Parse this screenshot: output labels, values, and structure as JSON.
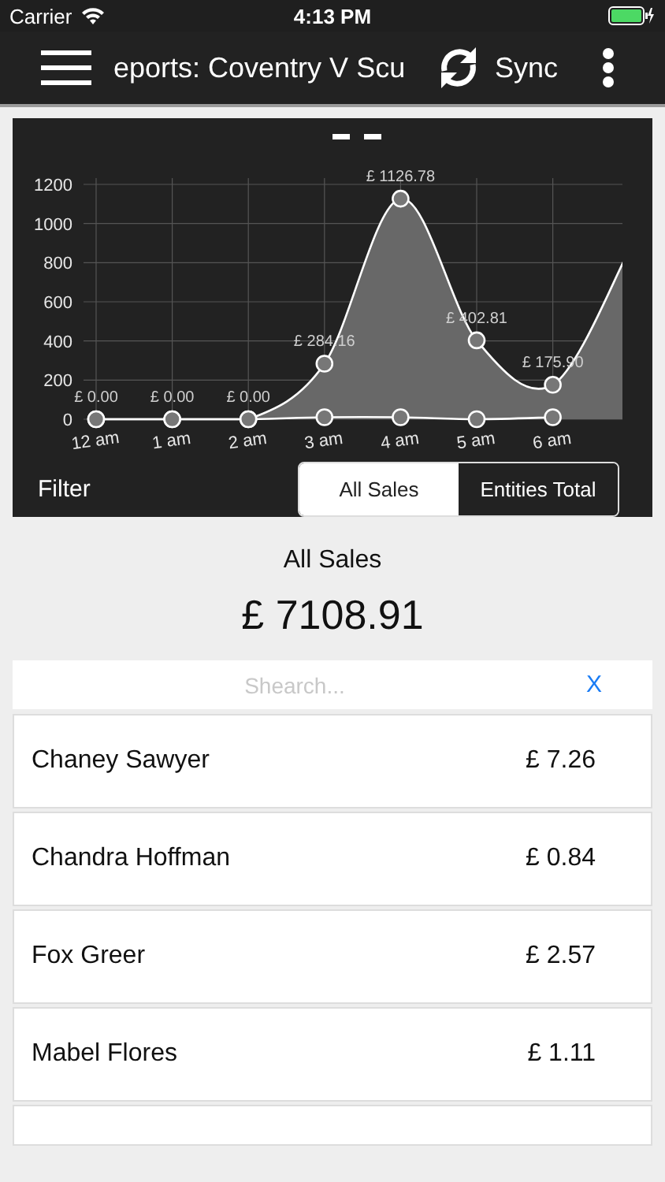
{
  "status_bar": {
    "carrier": "Carrier",
    "time": "4:13 PM"
  },
  "nav_bar": {
    "title": "eports: Coventry V Scu",
    "sync_label": "Sync"
  },
  "chart": {
    "tail_rises_past_edge": true,
    "chart_data": {
      "type": "line",
      "grid": true,
      "categories": [
        "12 am",
        "1 am",
        "2 am",
        "3 am",
        "4 am",
        "5 am",
        "6 am"
      ],
      "yticks": [
        0,
        200,
        400,
        600,
        800,
        1000,
        1200
      ],
      "ylim": [
        0,
        1200
      ],
      "series": [
        {
          "type": "area",
          "marker": "circle",
          "color": "#ffffff",
          "values": [
            0,
            0,
            0,
            284,
            1127,
            403,
            176
          ]
        },
        {
          "type": "line",
          "marker": "circle",
          "color": "#ffffff",
          "values": [
            0,
            0,
            0,
            10,
            10,
            0,
            10
          ]
        }
      ],
      "value_labels": [
        "£ 0.00",
        "£ 0.00",
        "£ 0.00",
        "£ 284.16",
        "£ 1126.78",
        "£ 402.81",
        "£ 175.90"
      ]
    }
  },
  "filter": {
    "label": "Filter",
    "options": [
      {
        "label": "All Sales",
        "selected": true
      },
      {
        "label": "Entities Total",
        "selected": false
      }
    ]
  },
  "summary": {
    "title": "All Sales",
    "total": "£ 7108.91"
  },
  "search": {
    "placeholder": "Shearch...",
    "clear": "X"
  },
  "rows": [
    {
      "name": "Chaney Sawyer",
      "amount": "£ 7.26"
    },
    {
      "name": "Chandra Hoffman",
      "amount": "£ 0.84"
    },
    {
      "name": "Fox Greer",
      "amount": "£ 2.57"
    },
    {
      "name": "Mabel Flores",
      "amount": "£ 1.11"
    }
  ],
  "more_rows_below": true
}
